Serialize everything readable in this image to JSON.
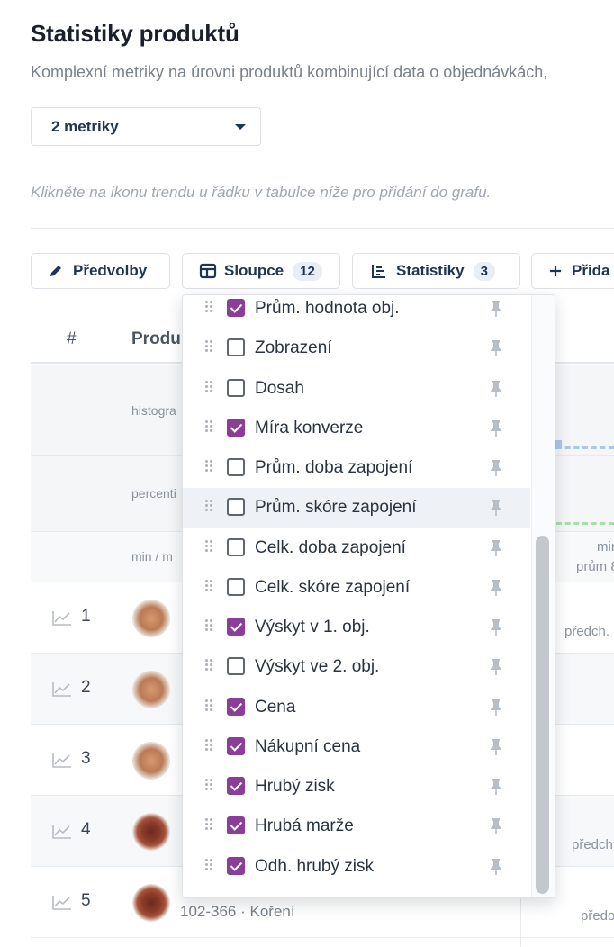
{
  "header": {
    "title": "Statistiky produktů",
    "subtitle": "Komplexní metriky na úrovni produktů kombinující data o objednávkách,"
  },
  "metric_select": {
    "value": "2 metriky"
  },
  "hint": "Klikněte na ikonu trendu u řádku v tabulce níže pro přidání do grafu.",
  "toolbar": {
    "presets_label": "Předvolby",
    "columns_label": "Sloupce",
    "columns_count": "12",
    "stats_label": "Statistiky",
    "stats_count": "3",
    "add_label": "Přida"
  },
  "table": {
    "col_hash": "#",
    "col_product": "Produ",
    "stat_rows": [
      "histogra",
      "percenti",
      "min / m"
    ],
    "right_texts": [
      "min",
      "prům 8",
      "předch.",
      "předch",
      "předo"
    ],
    "rows": [
      {
        "num": "1"
      },
      {
        "num": "2"
      },
      {
        "num": "3"
      },
      {
        "num": "4"
      },
      {
        "num": "5",
        "sku": "102-366 · Koření"
      }
    ]
  },
  "columns_dropdown": {
    "items": [
      {
        "label": "Prům. hodnota obj.",
        "checked": true
      },
      {
        "label": "Zobrazení",
        "checked": false
      },
      {
        "label": "Dosah",
        "checked": false
      },
      {
        "label": "Míra konverze",
        "checked": true
      },
      {
        "label": "Prům. doba zapojení",
        "checked": false
      },
      {
        "label": "Prům. skóre zapojení",
        "checked": false
      },
      {
        "label": "Celk. doba zapojení",
        "checked": false
      },
      {
        "label": "Celk. skóre zapojení",
        "checked": false
      },
      {
        "label": "Výskyt v 1. obj.",
        "checked": true
      },
      {
        "label": "Výskyt ve 2. obj.",
        "checked": false
      },
      {
        "label": "Cena",
        "checked": true
      },
      {
        "label": "Nákupní cena",
        "checked": true
      },
      {
        "label": "Hrubý zisk",
        "checked": true
      },
      {
        "label": "Hrubá marže",
        "checked": true
      },
      {
        "label": "Odh. hrubý zisk",
        "checked": true
      }
    ]
  },
  "colors": {
    "accent": "#8a3e97",
    "text_dark": "#1d3557",
    "dash_blue": "#a9c8f0",
    "dash_green": "#a7dfa8"
  }
}
